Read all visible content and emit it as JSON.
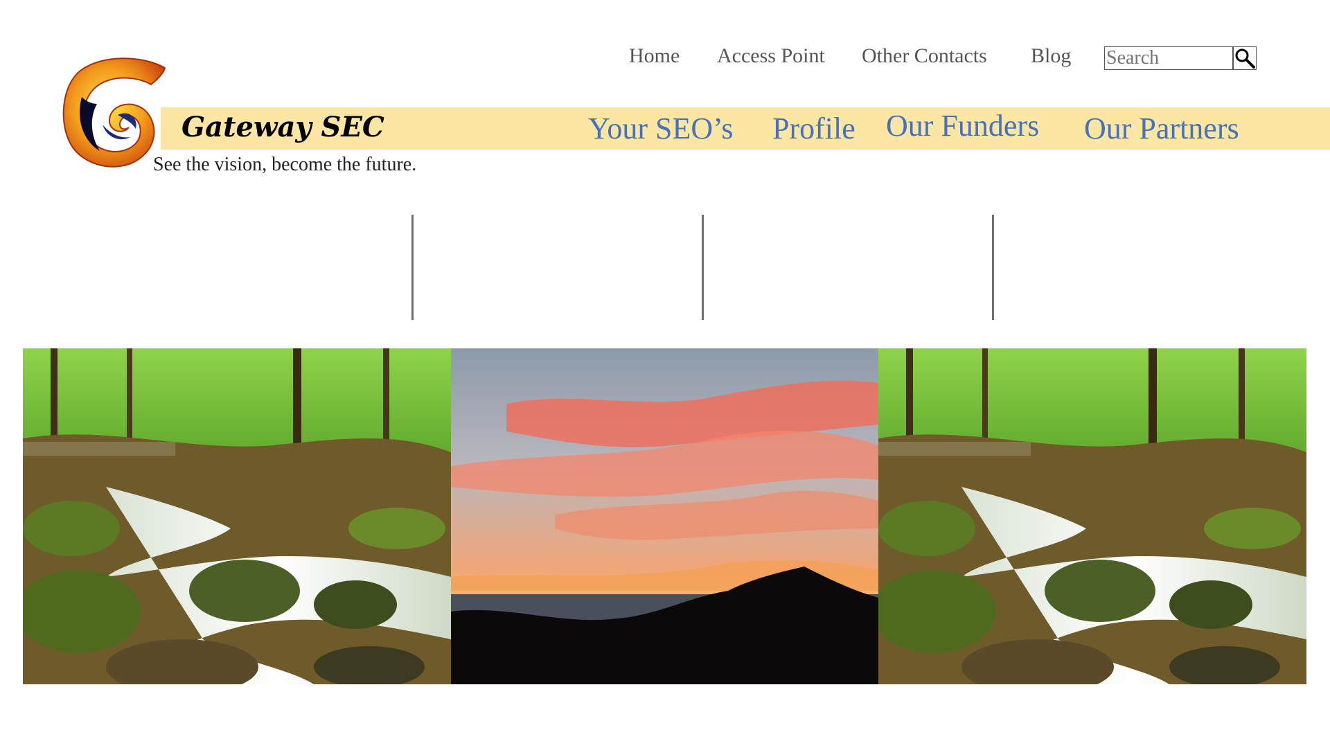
{
  "brand": {
    "name": "Gateway SEC",
    "tagline": "See the vision, become the future.",
    "logo_icon": "gateway-logo-icon"
  },
  "top_nav": {
    "items": [
      {
        "label": "Home"
      },
      {
        "label": "Access Point"
      },
      {
        "label": "Other Contacts"
      },
      {
        "label": "Blog"
      }
    ]
  },
  "search": {
    "placeholder": "Search",
    "icon": "magnifier-icon"
  },
  "main_nav": {
    "items": [
      {
        "label": "Your SEO’s"
      },
      {
        "label": "Profile"
      },
      {
        "label": "Our Funders"
      },
      {
        "label": "Our Partners"
      }
    ]
  },
  "gallery": {
    "images": [
      "forest-stream-photo",
      "sunset-mountain-photo",
      "forest-stream-photo"
    ]
  },
  "colors": {
    "banner": "#fbe7a3",
    "main_nav_text": "#4571bd",
    "top_nav_text": "#555555",
    "divider": "#6e6e6e"
  }
}
